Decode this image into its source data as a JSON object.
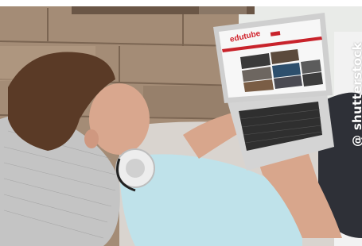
{
  "screen": {
    "brand_text": "edutube"
  },
  "watermark": {
    "text": "@ shutterstock"
  },
  "colors": {
    "wall_wood": "#9c8670",
    "shirt": "#bfe4ec",
    "pillow": "#c9c9c9",
    "laptop_body": "#d8d8d8",
    "brand_red": "#d0202a"
  }
}
